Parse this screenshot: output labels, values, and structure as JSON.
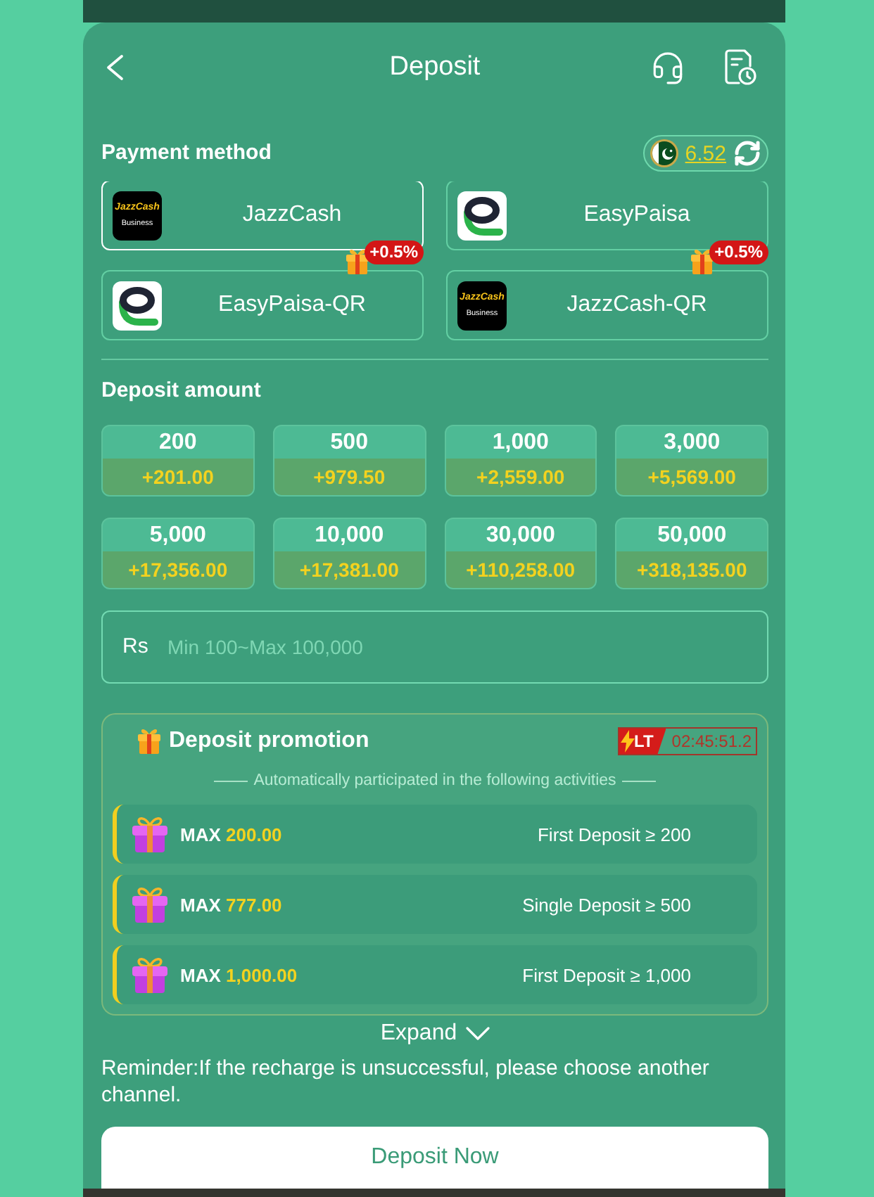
{
  "header": {
    "title": "Deposit"
  },
  "payment": {
    "title": "Payment method",
    "balance": "6.52",
    "methods": [
      {
        "name": "JazzCash",
        "kind": "tile",
        "logo_text": "JazzCash",
        "logo_subtext": "Business",
        "selected": true
      },
      {
        "name": "EasyPaisa",
        "kind": "ring",
        "selected": false
      },
      {
        "name": "EasyPaisa-QR",
        "kind": "ring",
        "badge": "+0.5%",
        "selected": false
      },
      {
        "name": "JazzCash-QR",
        "kind": "tile",
        "logo_text": "JazzCash",
        "logo_subtext": "Business",
        "badge": "+0.5%",
        "selected": false
      }
    ]
  },
  "amount": {
    "title": "Deposit amount",
    "options": [
      {
        "amount": "200",
        "bonus": "+201.00",
        "selected": false
      },
      {
        "amount": "500",
        "bonus": "+979.50",
        "selected": false
      },
      {
        "amount": "1,000",
        "bonus": "+2,559.00",
        "selected": false
      },
      {
        "amount": "3,000",
        "bonus": "+5,569.00",
        "selected": false
      },
      {
        "amount": "5,000",
        "bonus": "+17,356.00",
        "selected": false
      },
      {
        "amount": "10,000",
        "bonus": "+17,381.00",
        "selected": false
      },
      {
        "amount": "30,000",
        "bonus": "+110,258.00",
        "selected": false
      },
      {
        "amount": "50,000",
        "bonus": "+318,135.00",
        "selected": false
      }
    ],
    "field": {
      "prefix": "Rs",
      "placeholder": "Min 100~Max 100,000"
    }
  },
  "promotion": {
    "title": "Deposit promotion",
    "timer_tag": "LT",
    "timer": "02:45:51.2",
    "subtitle": "Automatically participated in the following activities",
    "activities": [
      {
        "max_label": "MAX",
        "max_value": "200.00",
        "condition": "First Deposit ≥ 200"
      },
      {
        "max_label": "MAX",
        "max_value": "777.00",
        "condition": "Single Deposit ≥ 500"
      },
      {
        "max_label": "MAX",
        "max_value": "1,000.00",
        "condition": "First Deposit ≥ 1,000"
      }
    ]
  },
  "expand": "Expand",
  "reminder": "Reminder:If the recharge is unsuccessful, please choose another channel.",
  "submit": "Deposit Now"
}
